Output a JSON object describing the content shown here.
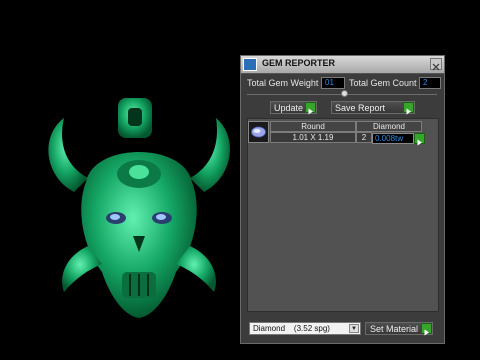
{
  "window": {
    "title": "GEM REPORTER"
  },
  "summary": {
    "weight_label": "Total Gem Weight",
    "weight_value": "01",
    "count_label": "Total Gem Count",
    "count_value": "2"
  },
  "actions": {
    "update_label": "Update",
    "save_label": "Save Report"
  },
  "table": {
    "headers": [
      "Round",
      "Diamond"
    ],
    "rows": [
      {
        "size": "1.01 X 1.19",
        "count": "2",
        "weight": "0.008tw"
      }
    ]
  },
  "material": {
    "selected": "Diamond    (3.52 spg)",
    "set_label": "Set Material"
  },
  "icons": {
    "app": "gem-reporter-icon",
    "close": "close-icon",
    "go": "green-arrow-icon",
    "gem": "round-gem-icon",
    "dropdown": "chevron-down-icon"
  },
  "colors": {
    "model": "#1fae6e",
    "accent_value": "#2f8be0",
    "go_button": "#37a42b"
  }
}
